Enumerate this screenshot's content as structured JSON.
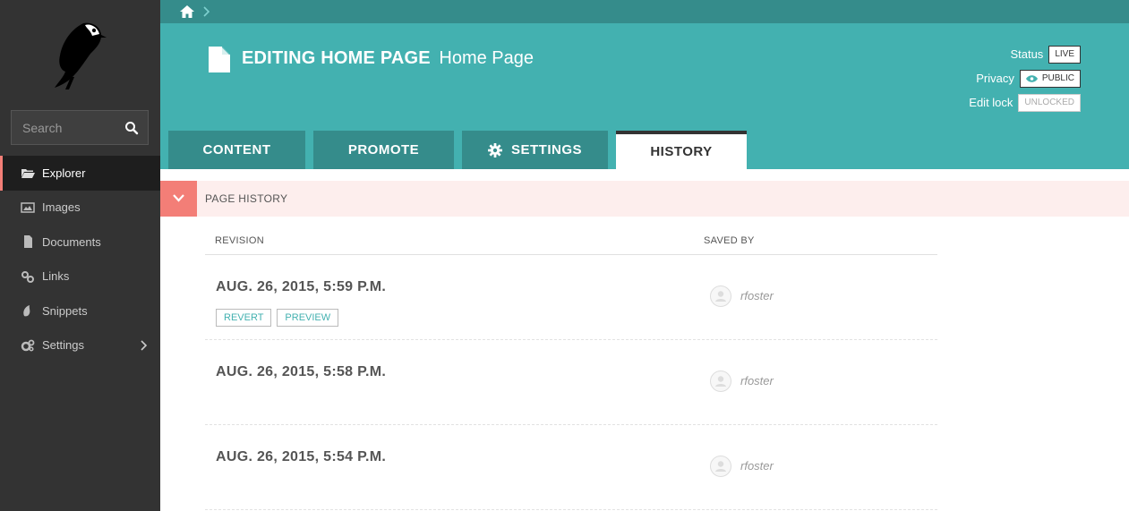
{
  "sidebar": {
    "search": {
      "placeholder": "Search"
    },
    "items": [
      {
        "label": "Explorer",
        "icon": "folder-open-icon"
      },
      {
        "label": "Images",
        "icon": "image-icon"
      },
      {
        "label": "Documents",
        "icon": "document-icon"
      },
      {
        "label": "Links",
        "icon": "link-icon"
      },
      {
        "label": "Snippets",
        "icon": "snippet-icon"
      },
      {
        "label": "Settings",
        "icon": "cogs-icon"
      }
    ]
  },
  "header": {
    "title_strong": "EDITING HOME PAGE",
    "title_sub": "Home Page",
    "status_label": "Status",
    "status_value": "LIVE",
    "privacy_label": "Privacy",
    "privacy_value": "PUBLIC",
    "editlock_label": "Edit lock",
    "editlock_value": "UNLOCKED"
  },
  "tabs": [
    {
      "label": "CONTENT"
    },
    {
      "label": "PROMOTE"
    },
    {
      "label": "SETTINGS"
    },
    {
      "label": "HISTORY"
    }
  ],
  "history": {
    "section_title": "PAGE HISTORY",
    "col_revision": "REVISION",
    "col_saved_by": "SAVED BY",
    "revert_label": "REVERT",
    "preview_label": "PREVIEW",
    "rows": [
      {
        "date": "AUG. 26, 2015, 5:59 P.M.",
        "user": "rfoster"
      },
      {
        "date": "AUG. 26, 2015, 5:58 P.M.",
        "user": "rfoster"
      },
      {
        "date": "AUG. 26, 2015, 5:54 P.M.",
        "user": "rfoster"
      }
    ]
  },
  "colors": {
    "sidebar_bg": "#333333",
    "header_teal": "#43b1b0",
    "tab_dark_teal": "#358c8b",
    "accent_salmon": "#f37e77"
  }
}
